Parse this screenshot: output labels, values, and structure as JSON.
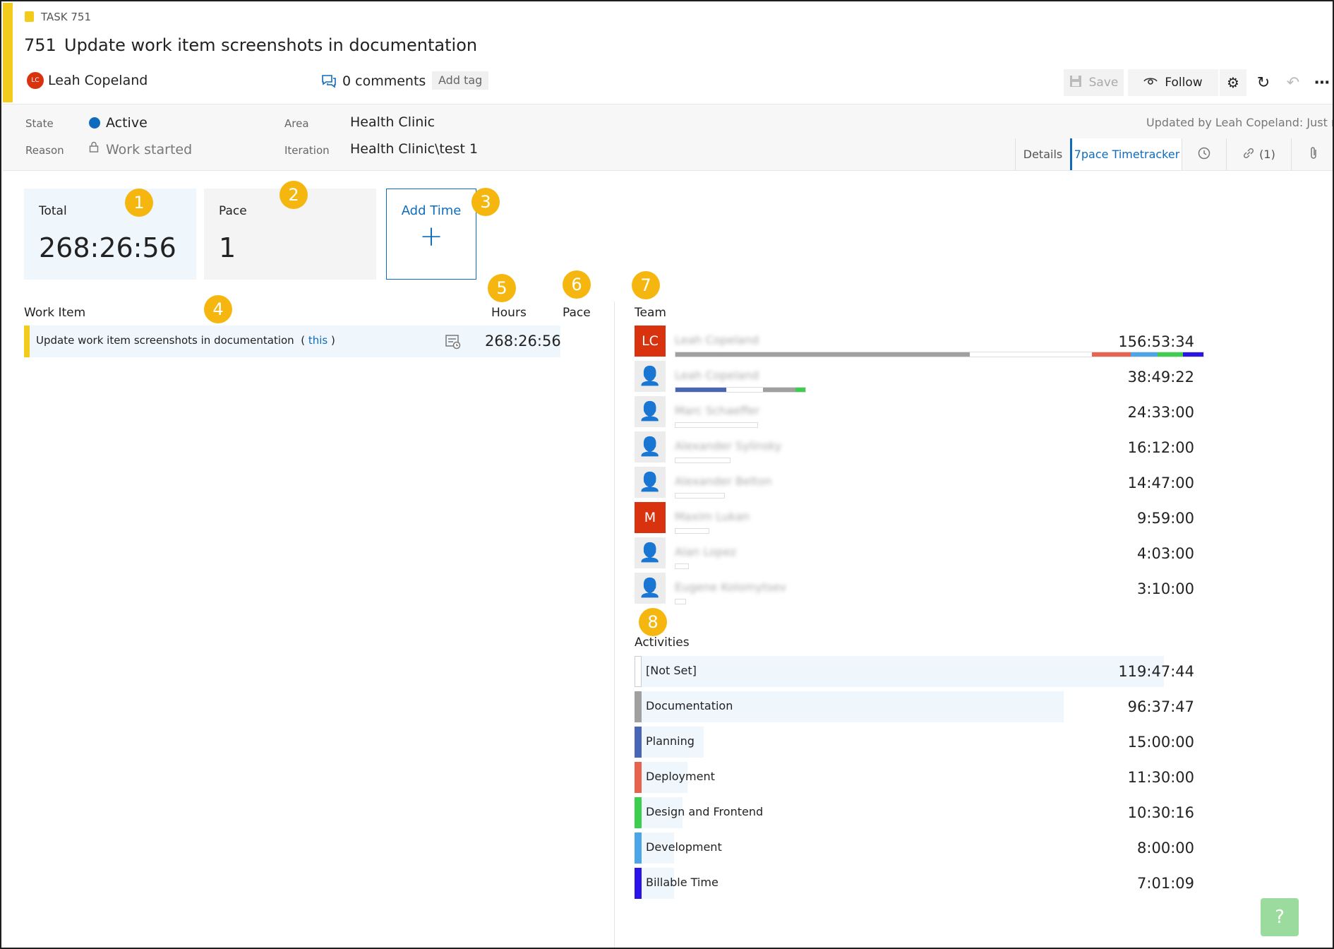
{
  "header": {
    "task_label": "TASK 751",
    "task_number": "751",
    "task_title": "Update work item screenshots in documentation",
    "owner_initials": "LC",
    "owner_name": "Leah Copeland",
    "comments": "0 comments",
    "add_tag": "Add tag",
    "save_label": "Save",
    "follow_label": "Follow"
  },
  "fields": {
    "state_label": "State",
    "state_value": "Active",
    "reason_label": "Reason",
    "reason_value": "Work started",
    "area_label": "Area",
    "area_value": "Health Clinic",
    "iteration_label": "Iteration",
    "iteration_value": "Health Clinic\\test 1",
    "updated": "Updated by Leah Copeland: Just now"
  },
  "tabs": [
    {
      "label": "Details"
    },
    {
      "label": "7pace Timetracker",
      "active": true
    },
    {
      "label": ""
    },
    {
      "label": "(1)"
    },
    {
      "label": ""
    }
  ],
  "summary": {
    "total_label": "Total",
    "total_value": "268:26:56",
    "pace_label": "Pace",
    "pace_value": "1",
    "add_time_label": "Add Time",
    "add_time_plus": "+"
  },
  "markers": [
    "1",
    "2",
    "3",
    "4",
    "5",
    "6",
    "7",
    "8"
  ],
  "work_items": {
    "col_work_item": "Work Item",
    "col_hours": "Hours",
    "col_pace": "Pace",
    "rows": [
      {
        "title": "Update work item screenshots in documentation",
        "this_open": "( ",
        "this_link": "this",
        "this_close": " )",
        "hours": "268:26:56"
      }
    ]
  },
  "team": {
    "title": "Team",
    "members": [
      {
        "initials": "LC",
        "avatar_color": "#d8330e",
        "name": "Leah Copeland",
        "hours": "156:53:34"
      },
      {
        "initials": "",
        "avatar_color": "",
        "name": "Leah Copeland",
        "hours": "38:49:22"
      },
      {
        "initials": "",
        "avatar_color": "",
        "name": "Marc Schaeffer",
        "hours": "24:33:00"
      },
      {
        "initials": "",
        "avatar_color": "",
        "name": "Alexander Sylinsky",
        "hours": "16:12:00"
      },
      {
        "initials": "",
        "avatar_color": "",
        "name": "Alexander Belton",
        "hours": "14:47:00"
      },
      {
        "initials": "M",
        "avatar_color": "#d8330e",
        "name": "Maxim Lukan",
        "hours": "9:59:00"
      },
      {
        "initials": "",
        "avatar_color": "",
        "name": "Alan Lopez",
        "hours": "4:03:00"
      },
      {
        "initials": "",
        "avatar_color": "",
        "name": "Eugene Kolomytsev",
        "hours": "3:10:00"
      }
    ]
  },
  "activities": {
    "title": "Activities",
    "items": [
      {
        "label": "[Not Set]",
        "hours": "119:47:44",
        "color": "#ffffff",
        "share": 1.0
      },
      {
        "label": "Documentation",
        "hours": "96:37:47",
        "color": "#a0a0a0",
        "share": 0.81
      },
      {
        "label": "Planning",
        "hours": "15:00:00",
        "color": "#4865b6",
        "share": 0.13
      },
      {
        "label": "Deployment",
        "hours": "11:30:00",
        "color": "#e8634d",
        "share": 0.1
      },
      {
        "label": "Design and Frontend",
        "hours": "10:30:16",
        "color": "#3ccf4e",
        "share": 0.09
      },
      {
        "label": "Development",
        "hours": "8:00:00",
        "color": "#4aa6e8",
        "share": 0.07
      },
      {
        "label": "Billable Time",
        "hours": "7:01:09",
        "color": "#2a14e8",
        "share": 0.06
      }
    ]
  },
  "help": "?"
}
